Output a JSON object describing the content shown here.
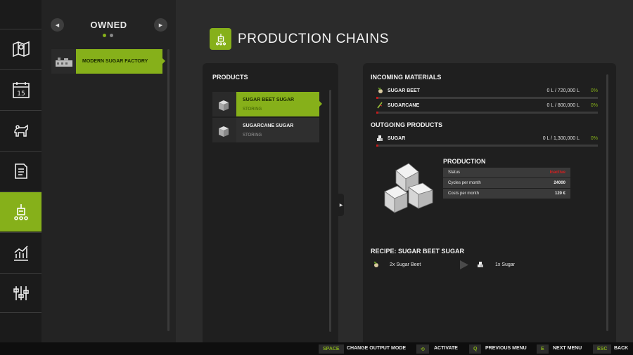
{
  "sidebar": {
    "items": [
      {
        "icon": "map-icon"
      },
      {
        "icon": "calendar-icon",
        "day": "15"
      },
      {
        "icon": "animals-icon"
      },
      {
        "icon": "contracts-icon"
      },
      {
        "icon": "production-icon"
      },
      {
        "icon": "statistics-icon"
      },
      {
        "icon": "settings-icon"
      }
    ]
  },
  "left_panel": {
    "title": "OWNED",
    "items": [
      {
        "label": "MODERN SUGAR FACTORY"
      }
    ]
  },
  "header": {
    "title": "PRODUCTION CHAINS"
  },
  "products": {
    "heading": "PRODUCTS",
    "items": [
      {
        "name": "SUGAR BEET SUGAR",
        "status": "STORING",
        "selected": true
      },
      {
        "name": "SUGARCANE SUGAR",
        "status": "STORING",
        "selected": false
      }
    ]
  },
  "incoming": {
    "heading": "INCOMING MATERIALS",
    "items": [
      {
        "name": "SUGAR BEET",
        "amount": "0 L / 720,000 L",
        "percent": "0%",
        "fill": 0
      },
      {
        "name": "SUGARCANE",
        "amount": "0 L / 800,000 L",
        "percent": "0%",
        "fill": 0
      }
    ]
  },
  "outgoing": {
    "heading": "OUTGOING PRODUCTS",
    "items": [
      {
        "name": "SUGAR",
        "amount": "0 L / 1,300,000 L",
        "percent": "0%",
        "fill": 0
      }
    ]
  },
  "production": {
    "heading": "PRODUCTION",
    "rows": [
      {
        "label": "Status",
        "value": "Inactive"
      },
      {
        "label": "Cycles per month",
        "value": "24000"
      },
      {
        "label": "Costs per month",
        "value": "120 €"
      }
    ]
  },
  "recipe": {
    "heading": "RECIPE: SUGAR BEET SUGAR",
    "input": "2x Sugar Beet",
    "output": "1x Sugar"
  },
  "bottom_bar": [
    {
      "key": "SPACE",
      "label": "CHANGE OUTPUT MODE"
    },
    {
      "key": "⟲",
      "label": "ACTIVATE"
    },
    {
      "key": "Q",
      "label": "PREVIOUS MENU"
    },
    {
      "key": "E",
      "label": "NEXT MENU"
    },
    {
      "key": "ESC",
      "label": "BACK"
    }
  ],
  "colors": {
    "accent": "#86b01a",
    "inactive": "#d42020",
    "bar_empty": "#c21b1b"
  }
}
